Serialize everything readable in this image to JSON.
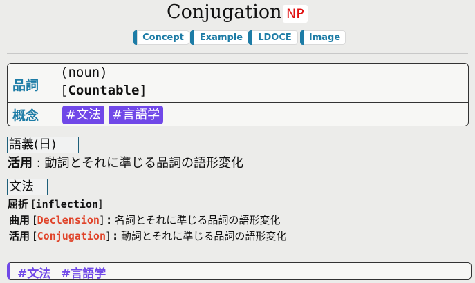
{
  "header": {
    "title": "Conjugation",
    "badge": "NP"
  },
  "links": [
    "Concept",
    "Example",
    "LDOCE",
    "Image"
  ],
  "info": {
    "pos_label": "品詞",
    "pos_value": "(noun)",
    "countable": "Countable",
    "concept_label": "概念",
    "tags": [
      "#文法",
      "#言語学"
    ]
  },
  "meaning": {
    "section_label": "語義(日)",
    "term": "活用",
    "definition": "動詞とそれに準じる品詞の語形変化"
  },
  "grammar": {
    "section_label": "文法",
    "inflection_label": "屈折",
    "inflection_term": "inflection",
    "declension_label": "曲用",
    "declension_term": "Declension",
    "declension_def": "名詞とそれに準じる品詞の語形変化",
    "conjugation_label": "活用",
    "conjugation_term": "Conjugation",
    "conjugation_def": "動詞とそれに準じる品詞の語形変化"
  },
  "footer": {
    "tags": [
      "#文法",
      "#言語学"
    ]
  },
  "colors": {
    "accent": "#1d7ca6",
    "tag_purple": "#7048e8",
    "badge_red": "#e01010",
    "highlight_red": "#e0442a"
  }
}
